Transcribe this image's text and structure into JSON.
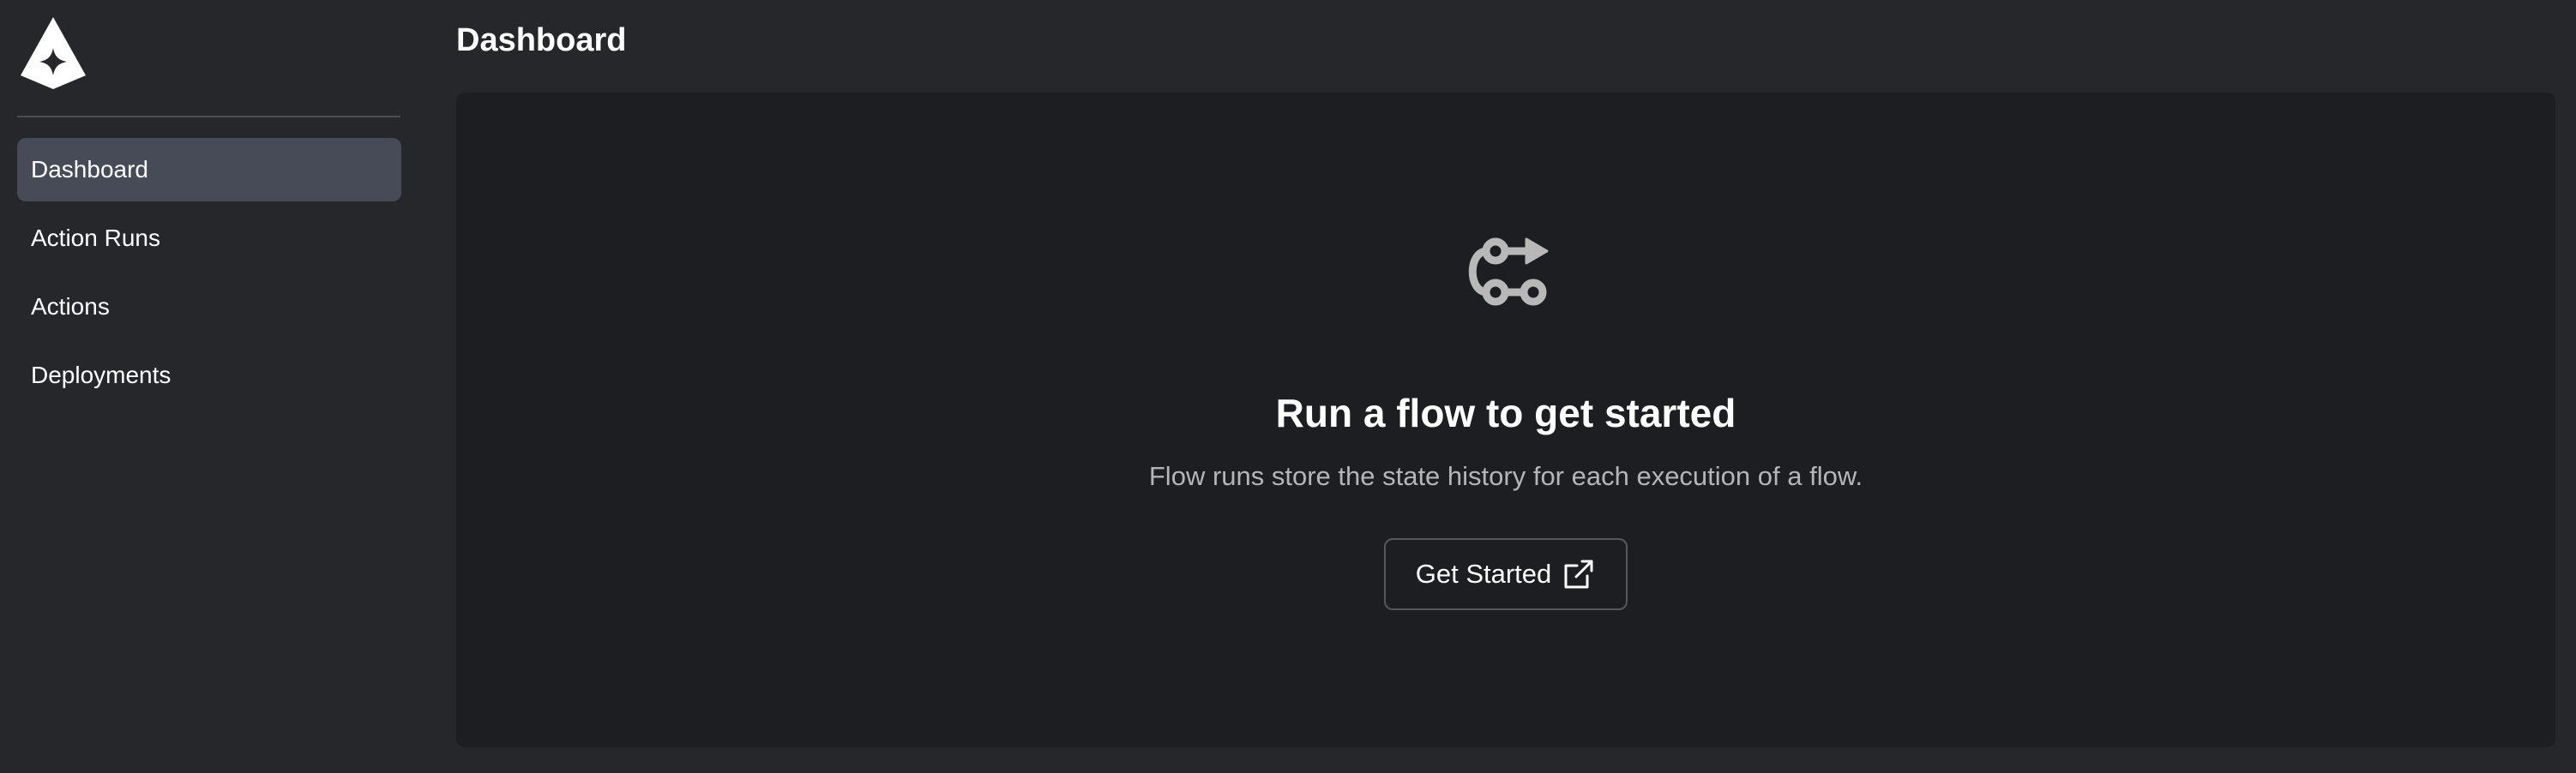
{
  "header": {
    "title": "Dashboard"
  },
  "sidebar": {
    "logo_icon": "prefect-logo-icon",
    "items": [
      {
        "label": "Dashboard",
        "active": true
      },
      {
        "label": "Action Runs",
        "active": false
      },
      {
        "label": "Actions",
        "active": false
      },
      {
        "label": "Deployments",
        "active": false
      }
    ]
  },
  "main": {
    "empty_state": {
      "icon": "flow-icon",
      "title": "Run a flow to get started",
      "description": "Flow runs store the state history for each execution of a flow.",
      "button_label": "Get Started",
      "button_icon": "external-link-icon"
    }
  },
  "colors": {
    "background": "#26272b",
    "panel": "#1d1e21",
    "active_nav": "#464b57",
    "muted_text": "#b3b5ba",
    "icon_gray": "#b8b8b8"
  }
}
